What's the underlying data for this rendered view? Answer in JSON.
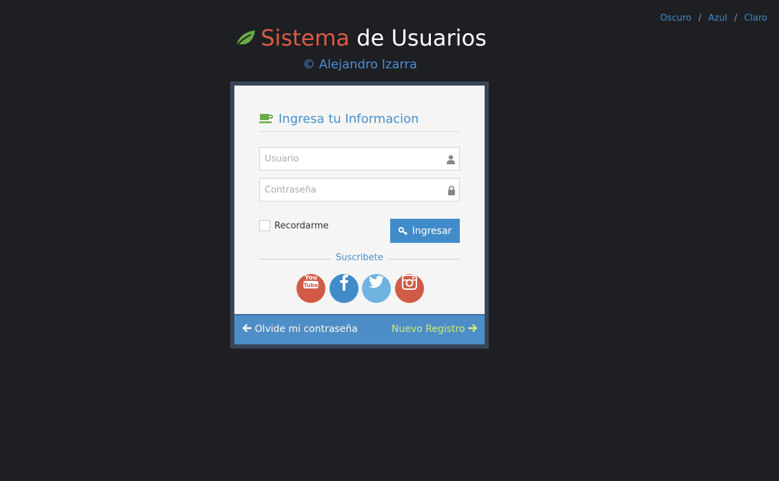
{
  "themes": {
    "dark": "Oscuro",
    "blue": "Azul",
    "light": "Claro",
    "separator": "/"
  },
  "header": {
    "title_part1": "Sistema",
    "title_part2": "de Usuarios",
    "credit": "© Alejandro Izarra"
  },
  "login": {
    "heading": "Ingresa tu Informacion",
    "username_placeholder": "Usuario",
    "password_placeholder": "Contraseña",
    "remember_label": "Recordarme",
    "submit_label": "Ingresar",
    "subscribe_label": "Suscribete"
  },
  "social": [
    {
      "name": "youtube",
      "color": "#d15b47"
    },
    {
      "name": "facebook",
      "color": "#428bca"
    },
    {
      "name": "twitter",
      "color": "#6fb3e0"
    },
    {
      "name": "instagram",
      "color": "#d15b47"
    }
  ],
  "footer": {
    "forgot_label": "Olvide mi contraseña",
    "register_label": "Nuevo Registro"
  },
  "colors": {
    "background": "#1d1f23",
    "accent": "#428bca",
    "title_red": "#dd5a43",
    "leaf_green": "#69aa46"
  },
  "icons": {
    "leaf": "leaf-icon",
    "cup": "coffee-icon",
    "user": "user-icon",
    "lock": "lock-icon",
    "key": "key-icon",
    "arrow_left": "arrow-left-icon",
    "arrow_right": "arrow-right-icon"
  }
}
